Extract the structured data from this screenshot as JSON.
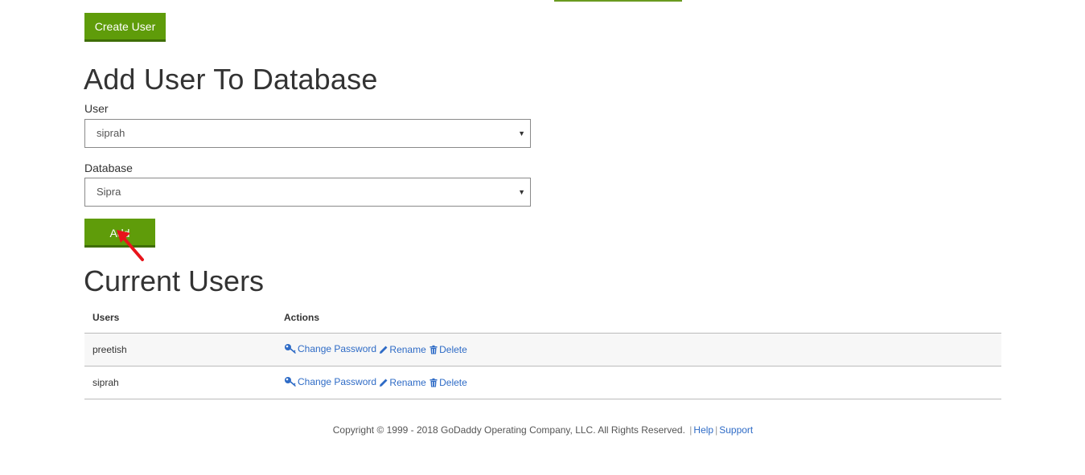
{
  "create_user_label": "Create User",
  "add_section": {
    "heading": "Add User To Database",
    "user_label": "User",
    "user_value": "siprah",
    "database_label": "Database",
    "database_value": "Sipra",
    "add_button_label": "Add"
  },
  "users_section": {
    "heading": "Current Users",
    "columns": [
      "Users",
      "Actions"
    ],
    "rows": [
      {
        "user": "preetish",
        "actions": {
          "change_password": "Change Password",
          "rename": "Rename",
          "delete": "Delete"
        }
      },
      {
        "user": "siprah",
        "actions": {
          "change_password": "Change Password",
          "rename": "Rename",
          "delete": "Delete"
        }
      }
    ]
  },
  "footer": {
    "copyright": "Copyright © 1999 - 2018 GoDaddy Operating Company, LLC. All Rights Reserved.",
    "sep": "|",
    "help": "Help",
    "support": "Support"
  },
  "icons": {
    "change_password": "key-icon",
    "rename": "pencil-icon",
    "delete": "trash-icon",
    "select": "caret-down-icon",
    "annotation": "red-arrow-icon"
  },
  "colors": {
    "button_green": "#5f9c0a",
    "link_blue": "#2e6bc6",
    "annotation_red": "#e8141b"
  }
}
